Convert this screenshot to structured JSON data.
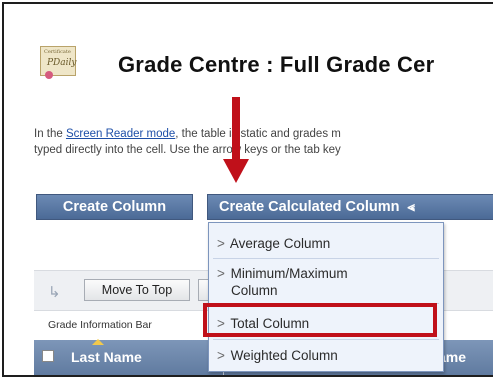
{
  "header": {
    "title": "Grade Centre : Full Grade Cer",
    "certificate_icon": {
      "name": "certificate-icon",
      "top_text": "Certificate",
      "signature": "PDaily"
    }
  },
  "info": {
    "line1_before": "In the ",
    "line1_link": "Screen Reader mode",
    "line1_after": ", the table is static and grades m",
    "line2": "typed directly into the cell. Use the arrow keys or the tab key"
  },
  "buttons": {
    "create_column": "Create Column",
    "create_calculated_column": "Create Calculated Column",
    "calc_chevron_icon": "double-chevron-down-icon"
  },
  "dropdown": {
    "items": [
      {
        "label": "Average Column"
      },
      {
        "label": "Minimum/Maximum"
      },
      {
        "label": "Total Column"
      },
      {
        "label": "Weighted Column"
      }
    ],
    "minmax_line2": "Column",
    "bullet": ">"
  },
  "toolbar": {
    "move_to_top": "Move To Top",
    "move_icon": "move-arrow-icon"
  },
  "grade_info_bar": {
    "label": "Grade Information Bar"
  },
  "table_header": {
    "last_name": "Last Name",
    "partial_column": "ame"
  },
  "annotation": {
    "highlight_color": "#c0101a",
    "highlighted_item": "Total Column"
  }
}
